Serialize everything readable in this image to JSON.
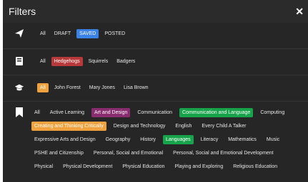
{
  "header": {
    "title": "Filters",
    "close_glyph": "✕"
  },
  "status_row": {
    "icon": "paper-plane-icon",
    "items": [
      "All",
      "DRAFT",
      "SAVED",
      "POSTED"
    ],
    "selected": "SAVED"
  },
  "group_row": {
    "icon": "book-icon",
    "items": [
      "All",
      "Hedgehogs",
      "Squirrels",
      "Badgers"
    ],
    "selected": "Hedgehogs"
  },
  "teacher_row": {
    "icon": "graduation-cap-icon",
    "items": [
      "All",
      "John Forest",
      "Mary Jones",
      "Lisa Brown"
    ],
    "selected": "All"
  },
  "tags_row": {
    "icon": "bookmark-icon",
    "items": [
      "All",
      "Active Learning",
      "Art and Design",
      "Communication",
      "Communication and Language",
      "Computing",
      "Creating and Thinking Critically",
      "Design and Technology",
      "English",
      "Every Child A Talker",
      "Expressive Arts and Design",
      "Geography",
      "History",
      "Languages",
      "Literacy",
      "Mathematics",
      "Music",
      "PSHE and Citizenship",
      "Personal, Social and Emotional",
      "Personal, Social and Emotional Development",
      "Physical",
      "Physical Development",
      "Physical Education",
      "Playing and Exploring",
      "Religious Education"
    ],
    "selected": {
      "Art and Design": "purple",
      "Communication and Language": "green",
      "Creating and Thinking Critically": "orange",
      "Languages": "green"
    }
  },
  "colors": {
    "panel": "#262626",
    "blue": "#3b82e6",
    "red": "#b8393a",
    "orange": "#f0a23e",
    "purple": "#8a2c70",
    "green": "#16a34a"
  }
}
